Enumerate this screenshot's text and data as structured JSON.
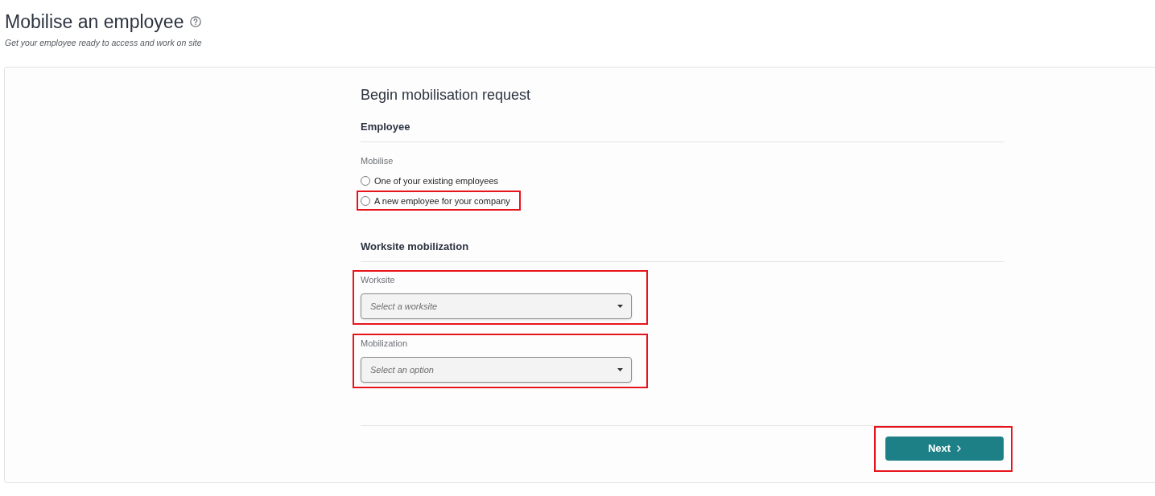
{
  "page": {
    "title": "Mobilise an employee",
    "subtitle": "Get your employee ready to access and work on site"
  },
  "form": {
    "title": "Begin mobilisation request",
    "sections": [
      {
        "heading": "Employee",
        "fields": [
          {
            "kind": "radio",
            "label": "Mobilise",
            "options": [
              {
                "label": "One of your existing employees",
                "selected": false,
                "highlighted": false
              },
              {
                "label": "A new employee for your company",
                "selected": false,
                "highlighted": true
              }
            ]
          }
        ]
      },
      {
        "heading": "Worksite mobilization",
        "fields": [
          {
            "kind": "select",
            "label": "Worksite",
            "placeholder": "Select a worksite",
            "highlighted": true
          },
          {
            "kind": "select",
            "label": "Mobilization",
            "placeholder": "Select an option",
            "highlighted": true
          }
        ]
      }
    ],
    "buttons": [
      {
        "label": "Next",
        "highlighted": true
      }
    ]
  }
}
